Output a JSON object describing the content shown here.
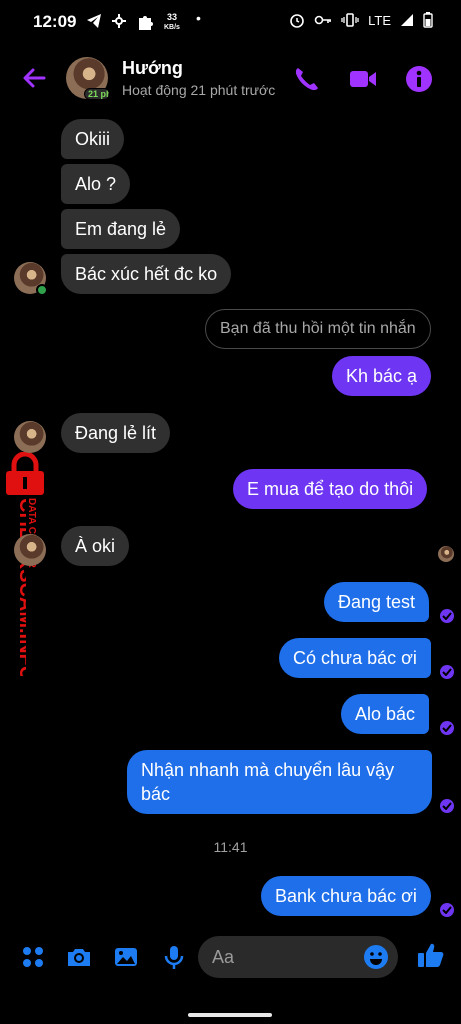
{
  "status_bar": {
    "time": "12:09",
    "net_speed_value": "33",
    "net_speed_unit": "KB/s",
    "network": "LTE"
  },
  "header": {
    "name": "Hướng",
    "status": "Hoạt động 21 phút trước",
    "avatar_badge": "21 phút"
  },
  "messages": {
    "m1": "Okiii",
    "m2": "Alo ?",
    "m3": "Em đang lẻ",
    "m4": "Bác xúc hết đc ko",
    "unsent": "Bạn đã thu hồi một tin nhắn",
    "m5": "Kh bác ạ",
    "m6": "Đang lẻ lít",
    "m7": "E mua để tạo do thôi",
    "m8": "À oki",
    "m9": "Đang test",
    "m10": "Có chưa bác ơi",
    "m11": "Alo bác",
    "m12_line1": "Nhận nhanh mà chuyển lâu vậy",
    "m12_line2": "bác",
    "timestamp": "11:41",
    "m13": "Bank chưa bác ơi"
  },
  "composer": {
    "placeholder": "Aa"
  },
  "watermark": {
    "brand": "CHECKSCAM.INFO",
    "sub": "DATA CENTER"
  },
  "colors": {
    "accent": "#a033ff",
    "outgoing_purple": "#6e36f2",
    "outgoing_blue": "#1f6fea",
    "incoming": "#303030",
    "composer_icon": "#1d7cf2",
    "watermark": "#e01010"
  }
}
